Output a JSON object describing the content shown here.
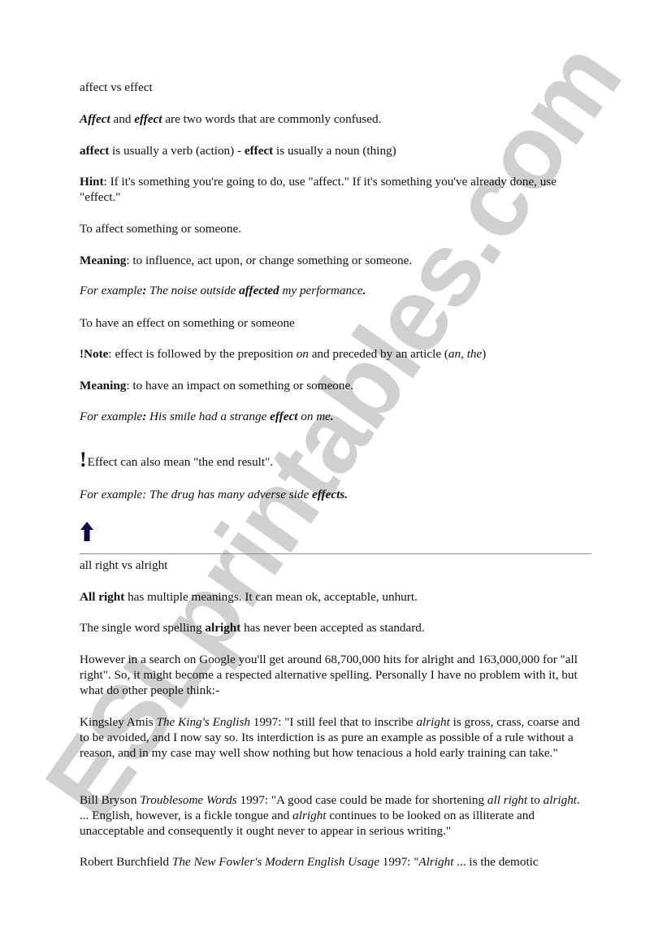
{
  "watermark": "ESLprintables.com",
  "section1": {
    "title": "affect vs effect",
    "intro": {
      "w1": "Affect",
      "t1": " and ",
      "w2": "effect",
      "t2": " are two words that are commonly confused."
    },
    "pos": {
      "w1": "affect",
      "t1": " is usually a verb (action) - ",
      "w2": "effect",
      "t2": " is usually a noun (thing)"
    },
    "hint": {
      "label": "Hint",
      "text": ": If it's something you're going to do, use \"affect.\" If it's something you've already done, use \"effect.\""
    },
    "affect_def": "To affect something or someone.",
    "meaning1": {
      "label": "Meaning",
      "text": ": to influence, act upon, or change something or someone."
    },
    "example1": {
      "lead": "For example",
      "colon": ":",
      "t1": " The noise outside ",
      "bold": "affected",
      "t2": " my performance",
      "end": "."
    },
    "effect_def": "To have an effect on something or someone",
    "note": {
      "label": "!Note",
      "t1": ": effect is followed by the preposition ",
      "on": "on",
      "t2": " and preceded by an article (",
      "an": "an",
      "comma": ", ",
      "the": "the",
      "t3": ")"
    },
    "meaning2": {
      "label": "Meaning",
      "text": ": to have an impact on something or someone."
    },
    "example2": {
      "lead": "For example",
      "colon": ":",
      "t1": " His smile had a strange ",
      "bold": "effect",
      "t2": " on me",
      "end": "."
    },
    "end_result": {
      "bang": "!",
      "text": "Effect can also mean \"the end result\"."
    },
    "example3": {
      "lead": "For example",
      "colon": ":",
      "t1": " The drug has many adverse side ",
      "bold": "effects",
      "end": "."
    },
    "back_to_top_icon": "up-arrow"
  },
  "section2": {
    "title": "all right vs alright",
    "p1": {
      "bold": "All right",
      "text": " has multiple meanings. It can mean ok, acceptable, unhurt."
    },
    "p2": {
      "t1": "The single word spelling ",
      "bold": "alright",
      "t2": " has never been accepted as standard."
    },
    "p3": "However in a search on Google you'll get around 68,700,000 hits for alright and 163,000,000 for \"all right\". So, it might become a respected alternative spelling. Personally I have no problem with it, but what do other people think:-",
    "quote1": {
      "author": "Kingsley Amis ",
      "book": "The King's English",
      "t1": " 1997: \"I still feel that to inscribe ",
      "i1": "alright",
      "t2": " is gross, crass, coarse and to be avoided, and I now say so. Its interdiction is as pure an example as possible of a rule without a reason, and in my case may well show nothing but how tenacious a hold early training can take.\""
    },
    "quote2": {
      "author": "Bill Bryson ",
      "book": "Troublesome Words",
      "t1": " 1997: \"A good case could be made for shortening ",
      "i1": "all right",
      "t2": " to ",
      "i2": "alright",
      "t3": ". ... English, however, is a fickle tongue and ",
      "i3": "alright",
      "t4": " continues to be looked on as illiterate and unacceptable and consequently it ought never to appear in serious writing.\""
    },
    "quote3": {
      "author": "Robert Burchfield ",
      "book": "The New Fowler's Modern English Usage",
      "t1": " 1997: \"",
      "i1": "Alright",
      "t2": " ... is the demotic"
    }
  }
}
